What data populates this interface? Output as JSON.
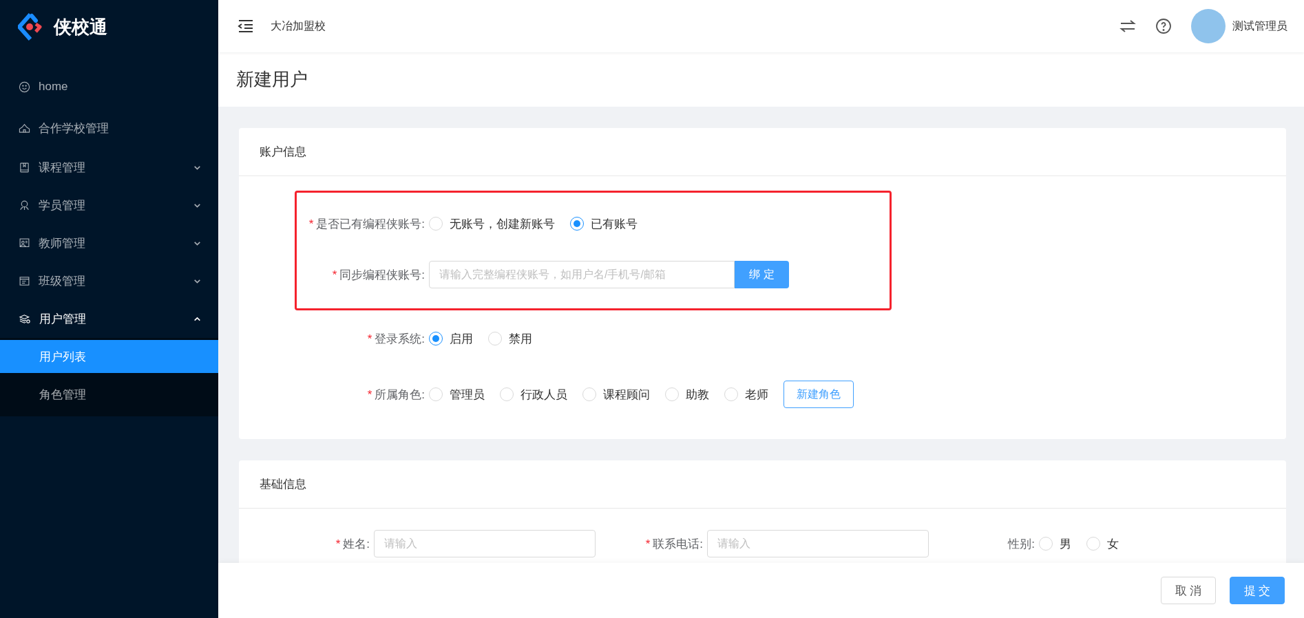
{
  "brand": {
    "name": "侠校通"
  },
  "sidebar": {
    "items": [
      {
        "label": "home",
        "kind": "link"
      },
      {
        "label": "合作学校管理",
        "kind": "link"
      },
      {
        "label": "课程管理",
        "kind": "group",
        "expanded": false
      },
      {
        "label": "学员管理",
        "kind": "group",
        "expanded": false
      },
      {
        "label": "教师管理",
        "kind": "group",
        "expanded": false
      },
      {
        "label": "班级管理",
        "kind": "group",
        "expanded": false
      },
      {
        "label": "用户管理",
        "kind": "group",
        "expanded": true,
        "children": [
          {
            "label": "用户列表",
            "selected": true
          },
          {
            "label": "角色管理",
            "selected": false
          }
        ]
      }
    ]
  },
  "header": {
    "school": "大冶加盟校",
    "user": "测试管理员"
  },
  "page_title": "新建用户",
  "account_card": {
    "title": "账户信息",
    "has_account": {
      "label": "是否已有编程侠账号:",
      "required_mark": "*",
      "options": [
        {
          "label": "无账号，创建新账号",
          "selected": false
        },
        {
          "label": "已有账号",
          "selected": true
        }
      ]
    },
    "sync_account": {
      "label": "同步编程侠账号:",
      "required_mark": "*",
      "placeholder": "请输入完整编程侠账号，如用户名/手机号/邮箱",
      "button": "绑 定"
    },
    "login_system": {
      "label": "登录系统:",
      "required_mark": "*",
      "options": [
        {
          "label": "启用",
          "selected": true
        },
        {
          "label": "禁用",
          "selected": false
        }
      ]
    },
    "role": {
      "label": "所属角色:",
      "required_mark": "*",
      "options": [
        {
          "label": "管理员",
          "selected": false
        },
        {
          "label": "行政人员",
          "selected": false
        },
        {
          "label": "课程顾问",
          "selected": false
        },
        {
          "label": "助教",
          "selected": false
        },
        {
          "label": "老师",
          "selected": false
        }
      ],
      "button": "新建角色"
    }
  },
  "basic_card": {
    "title": "基础信息",
    "name": {
      "label": "姓名:",
      "required_mark": "*",
      "placeholder": "请输入"
    },
    "phone": {
      "label": "联系电话:",
      "required_mark": "*",
      "placeholder": "请输入"
    },
    "gender": {
      "label": "性别:",
      "options": [
        {
          "label": "男",
          "selected": false
        },
        {
          "label": "女",
          "selected": false
        }
      ]
    }
  },
  "footer": {
    "cancel": "取 消",
    "submit": "提 交"
  }
}
